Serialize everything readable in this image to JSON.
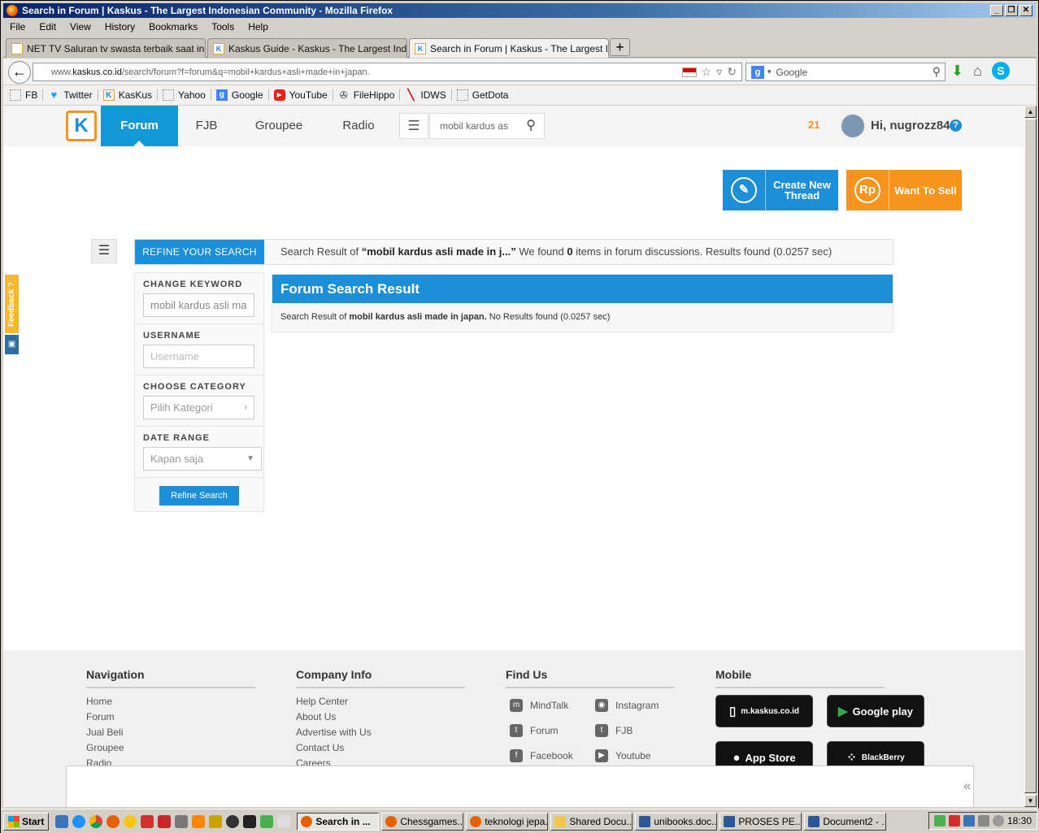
{
  "window": {
    "title": "Search in Forum | Kaskus - The Largest Indonesian Community - Mozilla Firefox"
  },
  "menu": [
    "File",
    "Edit",
    "View",
    "History",
    "Bookmarks",
    "Tools",
    "Help"
  ],
  "tabs": [
    {
      "label": "NET TV Saluran tv swasta terbaik saat ini ...",
      "close": "×"
    },
    {
      "label": "Kaskus Guide - Kaskus - The Largest Indo...",
      "close": "×"
    },
    {
      "label": "Search in Forum | Kaskus - The Largest In...",
      "close": "×"
    }
  ],
  "newtab": "+",
  "address": {
    "prefix": "www.",
    "domain": "kaskus.co.id",
    "path": "/search/forum?f=forum&q=mobil+kardus+asli+made+in+japan."
  },
  "search_engine": {
    "placeholder": "Google"
  },
  "bookmarks": [
    {
      "label": "FB",
      "icon": "page-icon"
    },
    {
      "label": "Twitter",
      "icon": "twitter-icon"
    },
    {
      "label": "KasKus",
      "icon": "kaskus-icon"
    },
    {
      "label": "Yahoo",
      "icon": "page-icon"
    },
    {
      "label": "Google",
      "icon": "google-icon"
    },
    {
      "label": "YouTube",
      "icon": "youtube-icon"
    },
    {
      "label": "FileHippo",
      "icon": "filehippo-icon"
    },
    {
      "label": "IDWS",
      "icon": "idws-icon"
    },
    {
      "label": "GetDota",
      "icon": "page-icon"
    }
  ],
  "kaskus": {
    "logo": "K",
    "nav": [
      "Forum",
      "FJB",
      "Groupee",
      "Radio"
    ],
    "search_value": "mobil kardus as",
    "notif_count": "21",
    "greeting": "Hi, nugrozz84",
    "help": "?",
    "create_thread": "Create New Thread",
    "create_icon": "✎",
    "want_to_sell": "Want To Sell",
    "sell_icon": "Rp",
    "refine_tab": "REFINE YOUR SEARCH",
    "summary": {
      "pre": "Search Result of ",
      "query": "“mobil kardus asli made in j...”",
      "mid": " We found ",
      "count": "0",
      "post": " items in forum discussions. Results found (0.0257 sec)"
    },
    "sidebar": {
      "keyword_label": "CHANGE KEYWORD",
      "keyword_value": "mobil kardus asli ma",
      "username_label": "USERNAME",
      "username_placeholder": "Username",
      "category_label": "CHOOSE CATEGORY",
      "category_value": "Pilih Kategori",
      "date_label": "DATE RANGE",
      "date_value": "Kapan saja",
      "refine_button": "Refine Search"
    },
    "result": {
      "title": "Forum Search Result",
      "pre": "Search Result of ",
      "query": "mobil kardus asli made in japan.",
      "post": " No Results found (0.0257 sec)"
    },
    "footer": {
      "navigation": {
        "title": "Navigation",
        "links": [
          "Home",
          "Forum",
          "Jual Beli",
          "Groupee",
          "Radio"
        ]
      },
      "company": {
        "title": "Company Info",
        "links": [
          "Help Center",
          "About Us",
          "Advertise with Us",
          "Contact Us",
          "Careers"
        ]
      },
      "findus": {
        "title": "Find Us",
        "links": [
          "MindTalk",
          "Instagram",
          "Forum",
          "FJB",
          "Facebook",
          "Youtube"
        ]
      },
      "mobile": {
        "title": "Mobile",
        "badges": [
          "m.kaskus.co.id",
          "Google play",
          "App Store",
          "BlackBerry"
        ]
      }
    },
    "feedback": "Feedback ?"
  },
  "taskbar": {
    "start": "Start",
    "items": [
      "Search in ...",
      "Chessgames....",
      "teknologi jepa...",
      "Shared Docu...",
      "unibooks.doc...",
      "PROSES PE...",
      "Document2 - ..."
    ],
    "clock": "18:30"
  }
}
